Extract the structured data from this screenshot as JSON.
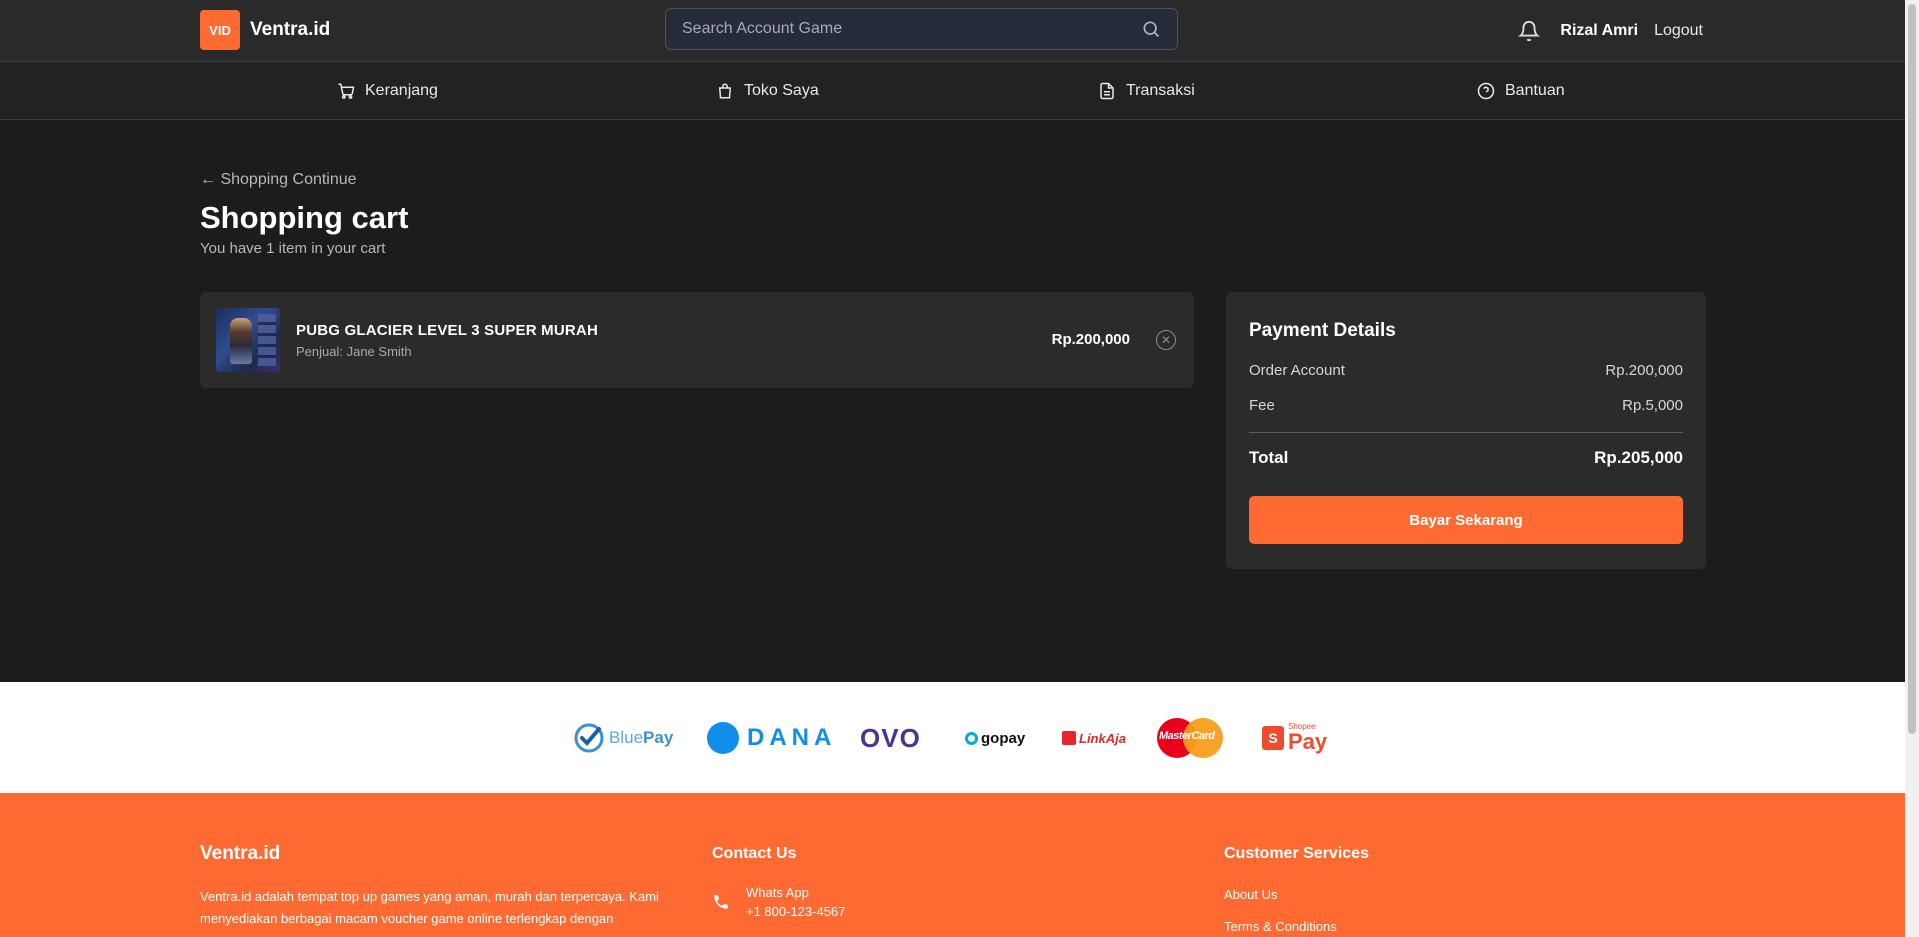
{
  "header": {
    "logo_badge": "VID",
    "brand": "Ventra.id",
    "search_placeholder": "Search Account Game",
    "user_name": "Rizal Amri",
    "logout_label": "Logout"
  },
  "nav": {
    "items": [
      {
        "label": "Keranjang",
        "icon": "cart-icon"
      },
      {
        "label": "Toko Saya",
        "icon": "shopping-bag-icon"
      },
      {
        "label": "Transaksi",
        "icon": "document-icon"
      },
      {
        "label": "Bantuan",
        "icon": "help-circle-icon"
      }
    ]
  },
  "cart": {
    "back_link": "← Shopping Continue",
    "title": "Shopping cart",
    "subtitle": "You have 1 item in your cart",
    "items": [
      {
        "name": "PUBG GLACIER LEVEL 3 SUPER MURAH",
        "seller": "Penjual: Jane Smith",
        "price": "Rp.200,000"
      }
    ]
  },
  "payment": {
    "title": "Payment Details",
    "order_label": "Order Account",
    "order_value": "Rp.200,000",
    "fee_label": "Fee",
    "fee_value": "Rp.5,000",
    "total_label": "Total",
    "total_value": "Rp.205,000",
    "pay_button": "Bayar Sekarang"
  },
  "payment_logos": {
    "bluepay_a": "Blue",
    "bluepay_b": "Pay",
    "dana": "DANA",
    "ovo": "OVO",
    "gopay": "gopay",
    "linkaja": "LinkAja",
    "mastercard": "MasterCard",
    "shopee_small": "Shopee",
    "shopee_pay": "Pay"
  },
  "footer": {
    "brand": "Ventra.id",
    "description": "Ventra.id adalah tempat top up games yang aman, murah dan terpercaya. Kami menyediakan berbagai macam voucher game online terlengkap dengan",
    "contact_heading": "Contact Us",
    "contact_label": "Whats App",
    "contact_phone": "+1 800-123-4567",
    "services_heading": "Customer Services",
    "services_links": [
      "About Us",
      "Terms & Conditions"
    ]
  },
  "colors": {
    "accent": "#ff6a33",
    "background": "#1c1c1c",
    "card": "#2b2b2b"
  }
}
